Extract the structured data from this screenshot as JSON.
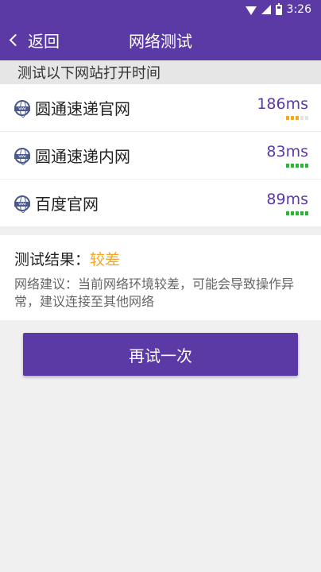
{
  "status_bar": {
    "time": "3:26"
  },
  "header": {
    "back_label": "返回",
    "title": "网络测试"
  },
  "section": {
    "title": "测试以下网站打开时间"
  },
  "sites": [
    {
      "name": "圆通速递官网",
      "latency": "186ms",
      "signal_level": 3,
      "signal_color": "#f5a623"
    },
    {
      "name": "圆通速递内网",
      "latency": "83ms",
      "signal_level": 5,
      "signal_color": "#2fb23a"
    },
    {
      "name": "百度官网",
      "latency": "89ms",
      "signal_level": 5,
      "signal_color": "#2fb23a"
    }
  ],
  "result": {
    "label": "测试结果：",
    "value": "较差",
    "advice": "网络建议：当前网络环境较差，可能会导致操作异常，建议连接至其他网络"
  },
  "retry_button": {
    "label": "再试一次"
  },
  "colors": {
    "primary": "#5b3aa6",
    "warning": "#f5a623",
    "good": "#2fb23a"
  }
}
